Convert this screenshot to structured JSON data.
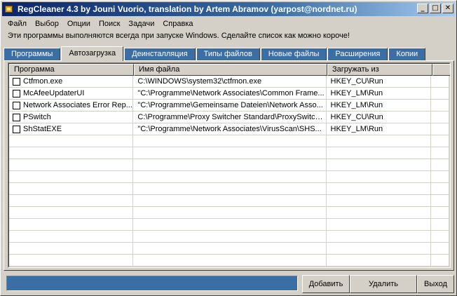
{
  "window": {
    "title": "RegCleaner 4.3 by Jouni Vuorio, translation by Artem Abramov (yarpost@nordnet.ru)",
    "minimize_glyph": "_",
    "maximize_glyph": "□",
    "close_glyph": "✕"
  },
  "menu": [
    "Файл",
    "Выбор",
    "Опции",
    "Поиск",
    "Задачи",
    "Справка"
  ],
  "hint": "Эти программы выполняются всегда при запуске Windows. Сделайте список как можно короче!",
  "tabs": [
    {
      "label": "Программы",
      "active": false
    },
    {
      "label": "Автозагрузка",
      "active": true
    },
    {
      "label": "Деинсталляция",
      "active": false
    },
    {
      "label": "Типы файлов",
      "active": false
    },
    {
      "label": "Новые файлы",
      "active": false
    },
    {
      "label": "Расширения",
      "active": false
    },
    {
      "label": "Копии",
      "active": false
    }
  ],
  "table": {
    "columns": [
      "Программа",
      "Имя файла",
      "Загружать из",
      ""
    ],
    "rows": [
      {
        "program": "Ctfmon.exe",
        "file": "C:\\WINDOWS\\system32\\ctfmon.exe",
        "source": "HKEY_CU\\Run"
      },
      {
        "program": "McAfeeUpdaterUI",
        "file": "\"C:\\Programme\\Network Associates\\Common Frame...",
        "source": "HKEY_LM\\Run"
      },
      {
        "program": "Network Associates Error Rep...",
        "file": "\"C:\\Programme\\Gemeinsame Dateien\\Network Asso...",
        "source": "HKEY_LM\\Run"
      },
      {
        "program": "PSwitch",
        "file": "C:\\Programme\\Proxy Switcher Standard\\ProxySwitch...",
        "source": "HKEY_CU\\Run"
      },
      {
        "program": "ShStatEXE",
        "file": "\"C:\\Programme\\Network Associates\\VirusScan\\SHS...",
        "source": "HKEY_LM\\Run"
      }
    ],
    "empty_rows": 12
  },
  "buttons": {
    "add": "Добавить",
    "delete": "Удалить",
    "exit": "Выход"
  },
  "colors": {
    "title_gradient_start": "#0a246a",
    "title_gradient_end": "#a6caf0",
    "tab_inactive": "#3a6ea5",
    "face": "#d4d0c8"
  }
}
